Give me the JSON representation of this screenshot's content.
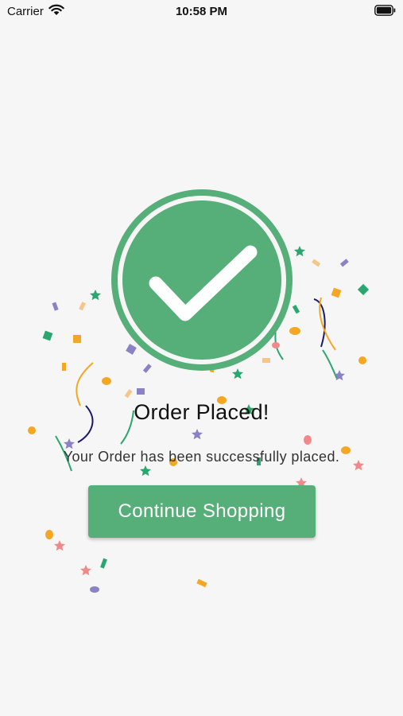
{
  "status_bar": {
    "carrier": "Carrier",
    "time": "10:58 PM",
    "wifi_icon": "wifi-icon",
    "battery_icon": "battery-icon"
  },
  "confirmation": {
    "icon": "checkmark-circle-icon",
    "title": "Order Placed!",
    "message": "Your Order has been successfully placed."
  },
  "actions": {
    "continue_label": "Continue Shopping"
  },
  "colors": {
    "accent": "#56ae79",
    "background": "#f6f6f6",
    "confetti": [
      "#2ba66e",
      "#f5a623",
      "#8a82c6",
      "#f08a8a",
      "#1c1a6e",
      "#f7c58a"
    ]
  }
}
